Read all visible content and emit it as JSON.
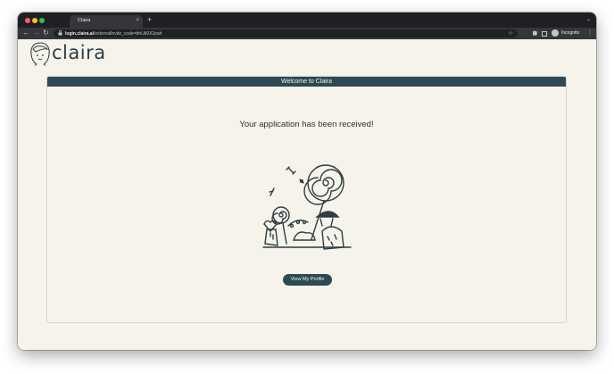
{
  "browser": {
    "tab_title": "Claira",
    "tab_close": "×",
    "new_tab": "+",
    "tab_menu": "⌄",
    "back": "←",
    "forward": "→",
    "reload": "↻",
    "url_host": "login.claira.ai",
    "url_path": "/externalInvite_code=bhUk9X2pah",
    "incognito_label": "Incognito",
    "icons": [
      "close-icon",
      "plus-icon",
      "lock-icon",
      "star-icon",
      "puzzle-icon",
      "side-panel-icon",
      "incognito-icon",
      "kebab-menu-icon"
    ]
  },
  "page": {
    "logo_text": "claira",
    "header": "Welcome to Claira",
    "message": "Your application has been received!",
    "button_label": "View My Profile"
  },
  "colors": {
    "brand_dark": "#2d4a54",
    "page_bg": "#f5f3ea"
  }
}
